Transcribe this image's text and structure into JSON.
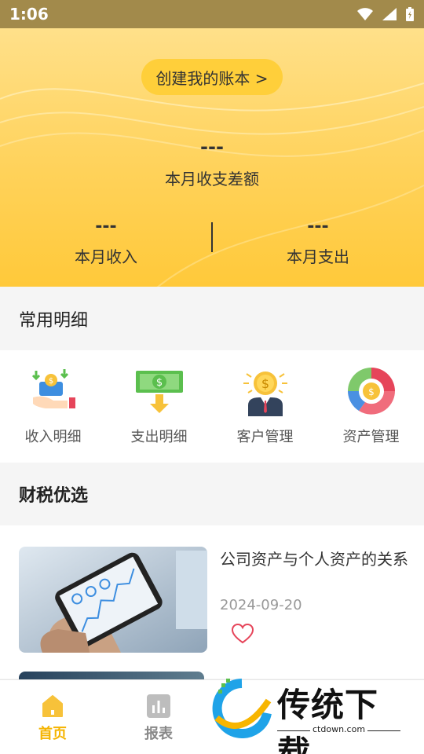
{
  "status_bar": {
    "time": "1:06"
  },
  "hero": {
    "create_button": "创建我的账本 >",
    "diff_value": "---",
    "diff_label": "本月收支差额",
    "income_value": "---",
    "income_label": "本月收入",
    "expense_value": "---",
    "expense_label": "本月支出"
  },
  "common": {
    "title": "常用明细",
    "items": [
      {
        "label": "收入明细",
        "icon": "income-icon"
      },
      {
        "label": "支出明细",
        "icon": "expense-icon"
      },
      {
        "label": "客户管理",
        "icon": "customer-icon"
      },
      {
        "label": "资产管理",
        "icon": "asset-icon"
      }
    ]
  },
  "finance": {
    "title": "财税优选",
    "articles": [
      {
        "title": "公司资产与个人资产的关系",
        "date": "2024-09-20"
      }
    ]
  },
  "nav": {
    "tabs": [
      {
        "label": "首页",
        "icon": "home-icon"
      },
      {
        "label": "报表",
        "icon": "report-icon"
      }
    ],
    "active_color": "#f5b400"
  },
  "watermark": {
    "text": "传统下载",
    "url": "ctdown.com"
  },
  "colors": {
    "accent": "#ffc93a",
    "status_bar": "#a28a4b"
  }
}
